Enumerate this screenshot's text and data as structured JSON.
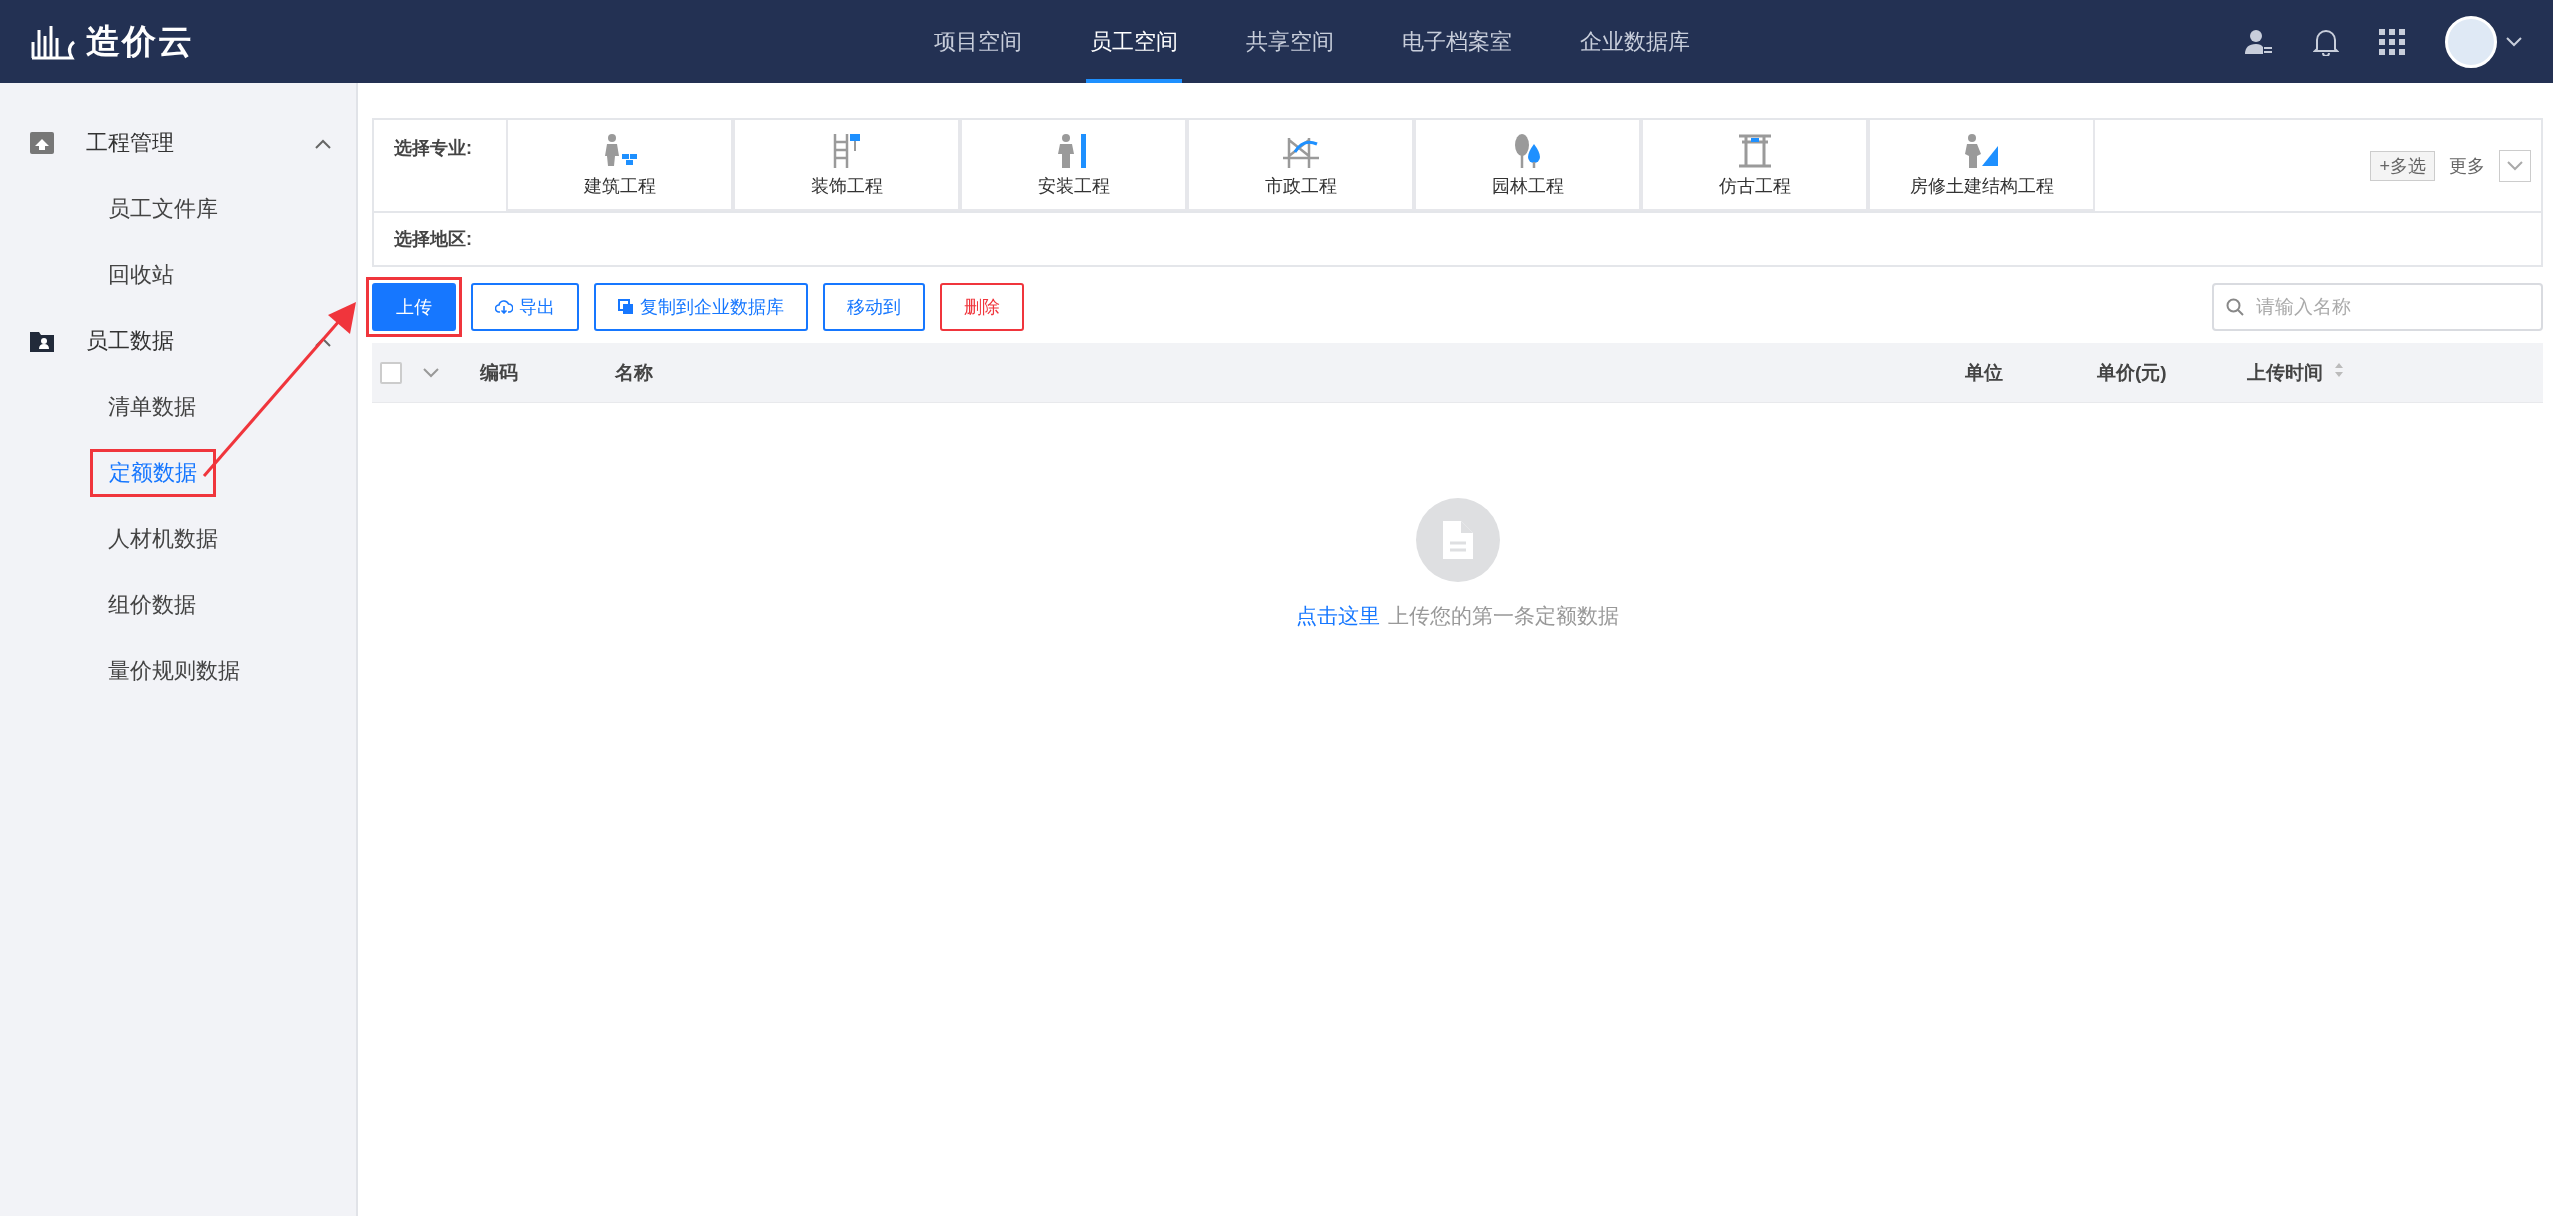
{
  "topbar": {
    "logo": "造价云",
    "tabs": [
      {
        "label": "项目空间",
        "selected": false
      },
      {
        "label": "员工空间",
        "selected": true
      },
      {
        "label": "共享空间",
        "selected": false
      },
      {
        "label": "电子档案室",
        "selected": false
      },
      {
        "label": "企业数据库",
        "selected": false
      }
    ]
  },
  "sidebar": {
    "groups": [
      {
        "label": "工程管理",
        "expanded": true,
        "children": [
          {
            "label": "员工文件库",
            "selected": false,
            "highlighted": false
          },
          {
            "label": "回收站",
            "selected": false,
            "highlighted": false
          }
        ]
      },
      {
        "label": "员工数据",
        "expanded": true,
        "children": [
          {
            "label": "清单数据",
            "selected": false,
            "highlighted": false
          },
          {
            "label": "定额数据",
            "selected": true,
            "highlighted": true
          },
          {
            "label": "人材机数据",
            "selected": false,
            "highlighted": false
          },
          {
            "label": "组价数据",
            "selected": false,
            "highlighted": false
          },
          {
            "label": "量价规则数据",
            "selected": false,
            "highlighted": false
          }
        ]
      }
    ]
  },
  "filters": {
    "specialty_label": "选择专业:",
    "specialties": [
      "建筑工程",
      "装饰工程",
      "安装工程",
      "市政工程",
      "园林工程",
      "仿古工程",
      "房修土建结构工程"
    ],
    "multi_select": "+多选",
    "more": "更多",
    "region_label": "选择地区:"
  },
  "toolbar": {
    "buttons": [
      {
        "label": "上传",
        "kind": "primary",
        "highlighted": true
      },
      {
        "label": "导出",
        "kind": "export",
        "highlighted": false
      },
      {
        "label": "复制到企业数据库",
        "kind": "copy",
        "highlighted": false
      },
      {
        "label": "移动到",
        "kind": "plain",
        "highlighted": false
      },
      {
        "label": "删除",
        "kind": "danger",
        "highlighted": false
      }
    ],
    "search": {
      "placeholder": "请输入名称"
    }
  },
  "table": {
    "select_all": {
      "checked": false
    },
    "columns": [
      "编码",
      "名称",
      "单位",
      "单价(元)",
      "上传时间"
    ]
  },
  "empty_state": {
    "link": "点击这里",
    "text": "上传您的第一条定额数据"
  }
}
